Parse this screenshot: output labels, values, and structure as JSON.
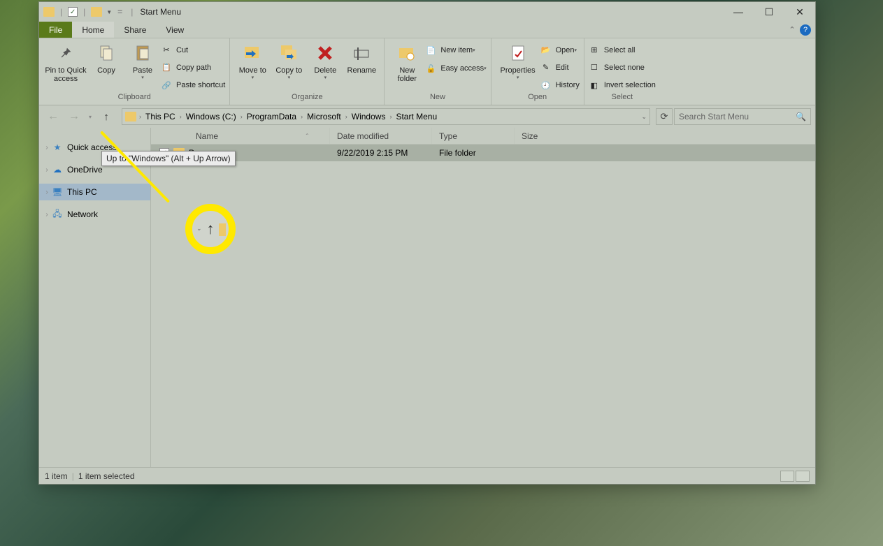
{
  "window": {
    "title": "Start Menu"
  },
  "menubar": {
    "file": "File",
    "home": "Home",
    "share": "Share",
    "view": "View"
  },
  "ribbon": {
    "clipboard": {
      "label": "Clipboard",
      "pin": "Pin to Quick access",
      "copy": "Copy",
      "paste": "Paste",
      "cut": "Cut",
      "copy_path": "Copy path",
      "paste_shortcut": "Paste shortcut"
    },
    "organize": {
      "label": "Organize",
      "move_to": "Move to",
      "copy_to": "Copy to",
      "delete": "Delete",
      "rename": "Rename"
    },
    "new": {
      "label": "New",
      "new_folder": "New folder",
      "new_item": "New item",
      "easy_access": "Easy access"
    },
    "open": {
      "label": "Open",
      "properties": "Properties",
      "open": "Open",
      "edit": "Edit",
      "history": "History"
    },
    "select": {
      "label": "Select",
      "select_all": "Select all",
      "select_none": "Select none",
      "invert": "Invert selection"
    }
  },
  "breadcrumb": {
    "parts": [
      "This PC",
      "Windows (C:)",
      "ProgramData",
      "Microsoft",
      "Windows",
      "Start Menu"
    ]
  },
  "search": {
    "placeholder": "Search Start Menu"
  },
  "sidebar": {
    "items": [
      {
        "label": "Quick access"
      },
      {
        "label": "OneDrive"
      },
      {
        "label": "This PC"
      },
      {
        "label": "Network"
      }
    ]
  },
  "columns": {
    "name": "Name",
    "date": "Date modified",
    "type": "Type",
    "size": "Size"
  },
  "rows": [
    {
      "name": "Programs",
      "date": "9/22/2019 2:15 PM",
      "type": "File folder",
      "size": ""
    }
  ],
  "statusbar": {
    "items": "1 item",
    "selected": "1 item selected"
  },
  "tooltip": "Up to \"Windows\" (Alt + Up Arrow)"
}
